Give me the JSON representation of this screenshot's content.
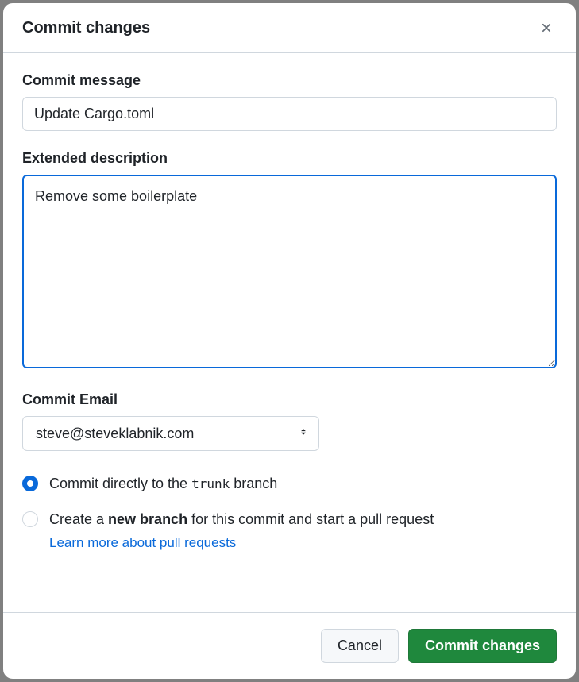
{
  "dialog": {
    "title": "Commit changes"
  },
  "fields": {
    "commit_message": {
      "label": "Commit message",
      "value": "Update Cargo.toml"
    },
    "extended_description": {
      "label": "Extended description",
      "value": "Remove some boilerplate"
    },
    "commit_email": {
      "label": "Commit Email",
      "value": "steve@steveklabnik.com"
    }
  },
  "branch_options": {
    "direct": {
      "prefix": "Commit directly to the ",
      "branch": "trunk",
      "suffix": " branch"
    },
    "new_branch": {
      "prefix": "Create a ",
      "bold": "new branch",
      "suffix": " for this commit and start a pull request",
      "learn_more": "Learn more about pull requests"
    }
  },
  "buttons": {
    "cancel": "Cancel",
    "commit": "Commit changes"
  }
}
